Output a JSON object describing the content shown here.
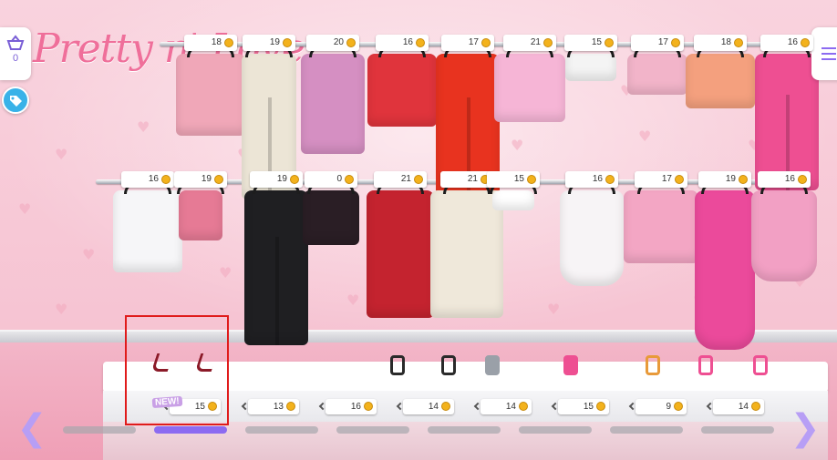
{
  "brand": {
    "logo_text": "Pretty n' Love",
    "accent_color": "#8c6bf1",
    "coin_color": "#f3b21c"
  },
  "basket": {
    "icon": "basket-icon",
    "count": "0"
  },
  "tag_button": {
    "icon": "price-tag-icon"
  },
  "menu_button": {
    "icon": "hamburger-menu-icon"
  },
  "rack_top": [
    {
      "price": "18",
      "color": "#f0a7b8"
    },
    {
      "price": "19",
      "color": "#ece5d6"
    },
    {
      "price": "20",
      "color": "#d58fc2"
    },
    {
      "price": "16",
      "color": "#e0343c"
    },
    {
      "price": "17",
      "color": "#e8331f"
    },
    {
      "price": "21",
      "color": "#f6b5d6"
    },
    {
      "price": "15",
      "color": "#f4f4f4"
    },
    {
      "price": "17",
      "color": "#f2b4c9"
    },
    {
      "price": "18",
      "color": "#f4a07e"
    },
    {
      "price": "16",
      "color": "#ee4f92"
    }
  ],
  "rack_mid": [
    {
      "price": "16",
      "color": "#f6f6f8"
    },
    {
      "price": "19",
      "color": "#e67a95"
    },
    {
      "price": "19",
      "color": "#1f1f22"
    },
    {
      "price": "0",
      "color": "#2a1e25"
    },
    {
      "price": "21",
      "color": "#c4232f"
    },
    {
      "price": "21",
      "color": "#efe8da"
    },
    {
      "price": "15",
      "color": "#ffffff"
    },
    {
      "price": "16",
      "color": "#f7f4f6"
    },
    {
      "price": "17",
      "color": "#f3a6c4"
    },
    {
      "price": "19",
      "color": "#eb4a9b"
    },
    {
      "price": "16",
      "color": "#f2a0c4"
    }
  ],
  "counter": {
    "new_badge": "NEW!",
    "items": [
      {
        "name": "red-heels",
        "price": "15",
        "is_new": true
      },
      {
        "name": "black-strappy-heels",
        "price": "13"
      },
      {
        "name": "black-sandals",
        "price": "16"
      },
      {
        "name": "silver-boots",
        "price": "14"
      },
      {
        "name": "pink-party-hat",
        "price": "14"
      },
      {
        "name": "beaded-necklace",
        "price": "15"
      },
      {
        "name": "pink-earrings",
        "price": "9"
      },
      {
        "name": "pink-heels",
        "price": "14"
      }
    ]
  },
  "pagination": {
    "pages": 8,
    "active_page": 2
  },
  "nav": {
    "prev_icon": "arrow-left-icon",
    "next_icon": "arrow-right-icon"
  }
}
